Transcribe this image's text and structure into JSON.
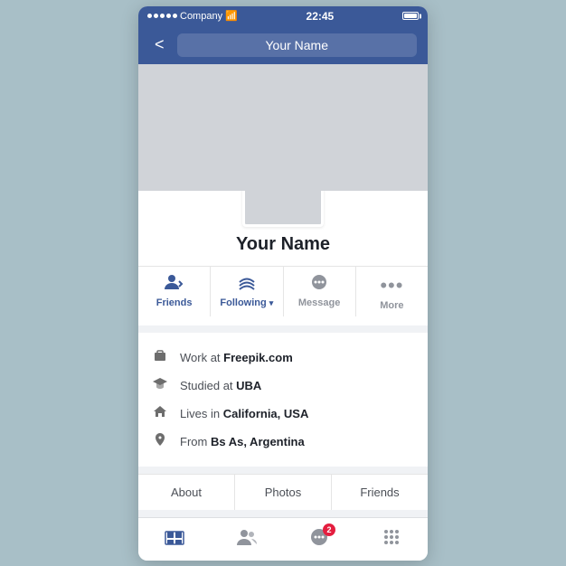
{
  "statusBar": {
    "carrier": "Company",
    "time": "22:45",
    "wifiSymbol": "⊕"
  },
  "navBar": {
    "backLabel": "<",
    "title": "Your Name"
  },
  "profile": {
    "name": "Your Name"
  },
  "actions": [
    {
      "id": "friends",
      "label": "Friends",
      "icon": "👤",
      "color": "blue"
    },
    {
      "id": "following",
      "label": "Following",
      "icon": "📡",
      "color": "blue",
      "hasDropdown": true
    },
    {
      "id": "message",
      "label": "Message",
      "icon": "💬",
      "color": "gray"
    },
    {
      "id": "more",
      "label": "More",
      "icon": "•••",
      "color": "gray"
    }
  ],
  "info": [
    {
      "icon": "🎓",
      "prefix": "Work at",
      "value": "Freepik.com"
    },
    {
      "icon": "🎓",
      "prefix": "Studied at",
      "value": "UBA"
    },
    {
      "icon": "🏠",
      "prefix": "Lives in",
      "value": "California, USA"
    },
    {
      "icon": "📍",
      "prefix": "From",
      "value": "Bs As, Argentina"
    }
  ],
  "tabs": [
    "About",
    "Photos",
    "Friends"
  ],
  "bottomNav": [
    {
      "id": "home",
      "icon": "⬛",
      "active": true,
      "badge": null
    },
    {
      "id": "friends-nav",
      "icon": "👥",
      "active": false,
      "badge": null
    },
    {
      "id": "notifications",
      "icon": "🔔",
      "active": false,
      "badge": "2"
    },
    {
      "id": "menu",
      "icon": "⋮⋮",
      "active": false,
      "badge": null
    }
  ]
}
